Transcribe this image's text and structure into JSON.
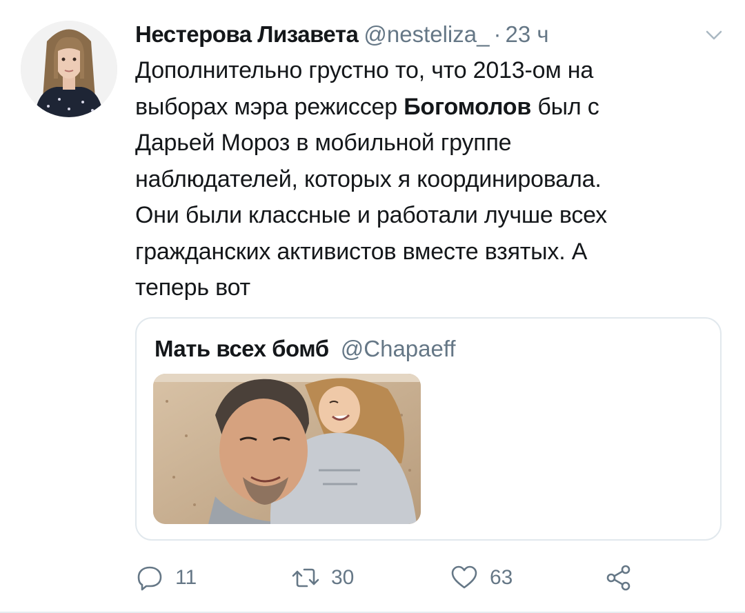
{
  "tweet": {
    "author": {
      "display_name": "Нестерова Лизавета",
      "handle": "@nesteliza_"
    },
    "separator": "·",
    "time": "23 ч",
    "text": {
      "line1": "Дополнительно грустно то, что 2013-ом на",
      "line2_before": "выборах мэра режиссер ",
      "line2_bold": "Богомолов",
      "line2_after": " был с",
      "line3": "Дарьей Мороз в мобильной группе",
      "line4": "наблюдателей, которых я координировала.",
      "line5": "Они были классные и работали лучше всех",
      "line6": "гражданских активистов вместе взятых. А",
      "line7": "теперь вот"
    },
    "quoted_tweet": {
      "display_name": "Мать всех бомб",
      "handle": "@Chapaeff"
    },
    "actions": {
      "reply_count": "11",
      "retweet_count": "30",
      "like_count": "63"
    },
    "icons": {
      "reply": "reply-icon",
      "retweet": "retweet-icon",
      "like": "heart-icon",
      "share": "share-icon",
      "menu": "chevron-down-icon"
    },
    "colors": {
      "text_primary": "#14171a",
      "text_secondary": "#657786",
      "border": "#e1e8ed"
    }
  }
}
